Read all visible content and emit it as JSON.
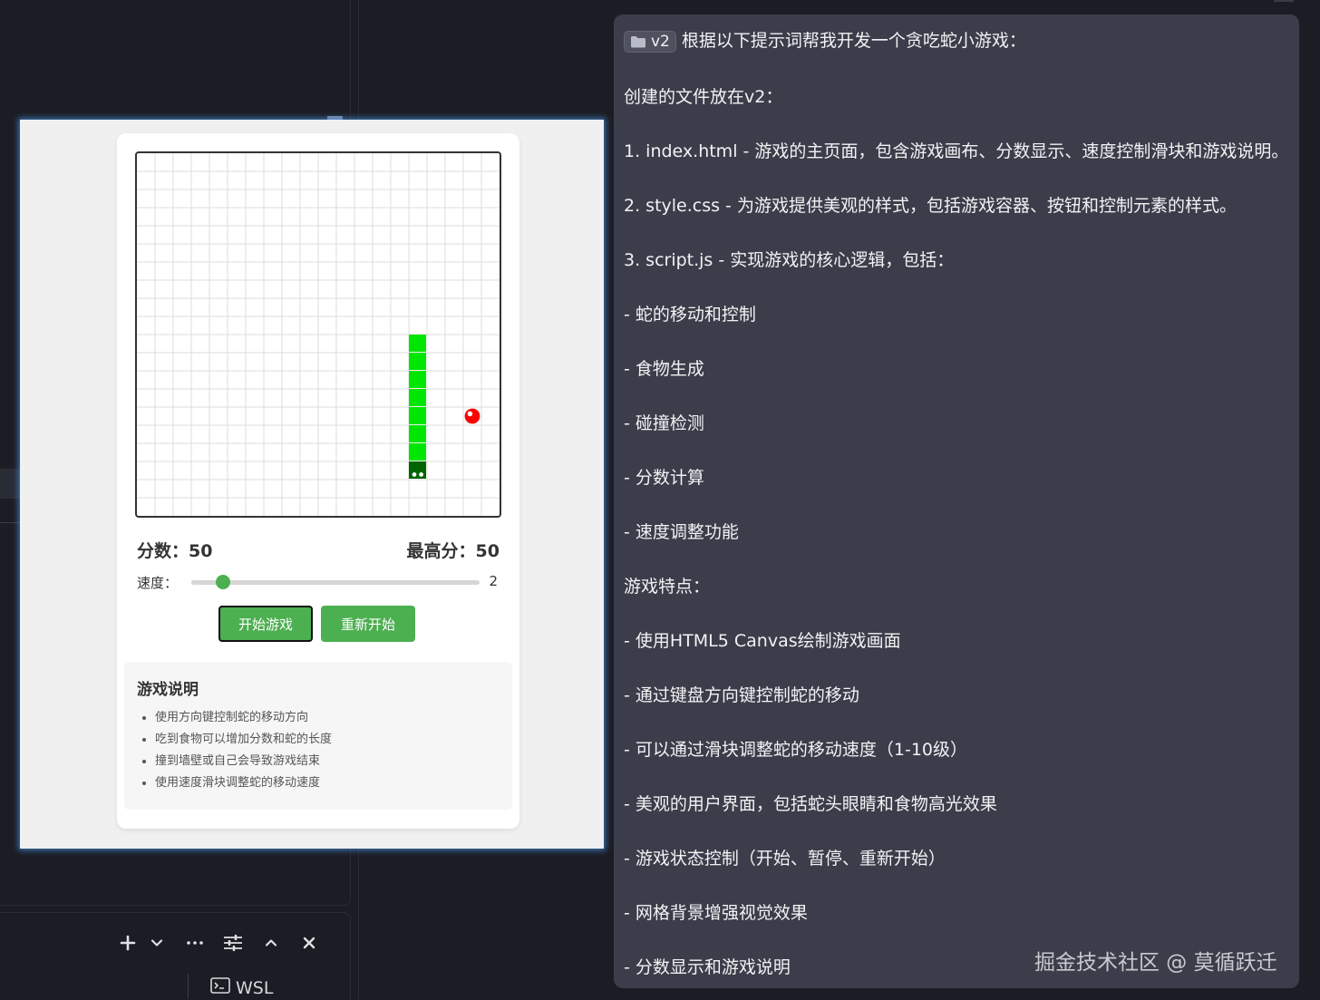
{
  "terminal": {
    "tab_label": "WSL",
    "tools": [
      "plus-icon",
      "chevron-down-icon",
      "more-icon",
      "sliders-icon",
      "chevron-up-icon",
      "close-icon"
    ]
  },
  "game": {
    "board": {
      "cols": 20,
      "rows": 20
    },
    "snake": {
      "color": "#00e600",
      "head_color": "#006400",
      "cells": [
        [
          15,
          10
        ],
        [
          15,
          11
        ],
        [
          15,
          12
        ],
        [
          15,
          13
        ],
        [
          15,
          14
        ],
        [
          15,
          15
        ],
        [
          15,
          16
        ],
        [
          15,
          17
        ]
      ]
    },
    "food": {
      "cell": [
        18,
        14
      ],
      "color": "#ff0000"
    },
    "score_label": "分数：50",
    "high_score_label": "最高分：50",
    "speed_label": "速度：",
    "speed": {
      "value": "2",
      "min": 1,
      "max": 10
    },
    "start_button": "开始游戏",
    "restart_button": "重新开始",
    "instructions": {
      "title": "游戏说明",
      "items": [
        "使用方向键控制蛇的移动方向",
        "吃到食物可以增加分数和蛇的长度",
        "撞到墙壁或自己会导致游戏结束",
        "使用速度滑块调整蛇的移动速度"
      ]
    }
  },
  "chat": {
    "chip_label": "v2",
    "lines": [
      "根据以下提示词帮我开发一个贪吃蛇小游戏：",
      "创建的文件放在v2：",
      "1. index.html - 游戏的主页面，包含游戏画布、分数显示、速度控制滑块和游戏说明。",
      "2. style.css - 为游戏提供美观的样式，包括游戏容器、按钮和控制元素的样式。",
      "3. script.js - 实现游戏的核心逻辑，包括：",
      "- 蛇的移动和控制",
      "- 食物生成",
      "- 碰撞检测",
      "- 分数计算",
      "- 速度调整功能",
      "游戏特点：",
      "- 使用HTML5 Canvas绘制游戏画面",
      "- 通过键盘方向键控制蛇的移动",
      "- 可以通过滑块调整蛇的移动速度（1-10级）",
      "- 美观的用户界面，包括蛇头眼睛和食物高光效果",
      "- 游戏状态控制（开始、暂停、重新开始）",
      "- 网格背景增强视觉效果",
      "- 分数显示和游戏说明"
    ]
  },
  "watermark": "掘金技术社区 @ 莫循跃迁"
}
